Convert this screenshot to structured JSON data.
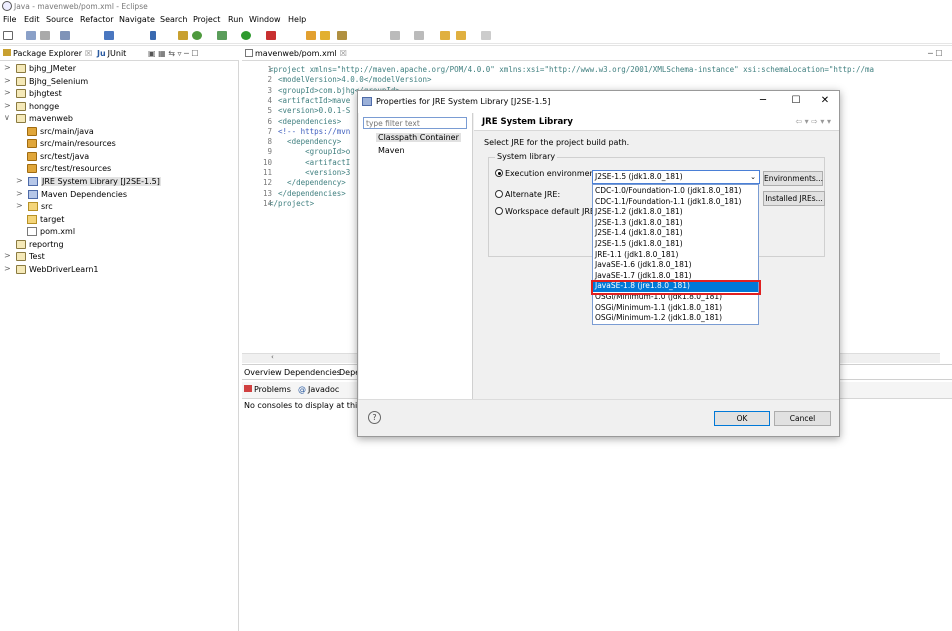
{
  "window": {
    "title": "Java - mavenweb/pom.xml - Eclipse"
  },
  "menu": [
    "File",
    "Edit",
    "Source",
    "Refactor",
    "Navigate",
    "Search",
    "Project",
    "Run",
    "Window",
    "Help"
  ],
  "explorer": {
    "tab_label": "Package Explorer",
    "tab2_label": "JUnit",
    "items": [
      {
        "label": "bjhg_JMeter",
        "expanded": false,
        "icon": "project-icon"
      },
      {
        "label": "Bjhg_Selenium",
        "expanded": false,
        "icon": "project-icon"
      },
      {
        "label": "bjhgtest",
        "expanded": false,
        "icon": "project-icon"
      },
      {
        "label": "hongge",
        "expanded": false,
        "icon": "project-icon"
      },
      {
        "label": "mavenweb",
        "expanded": true,
        "icon": "project-icon"
      },
      {
        "label": "src/main/java",
        "icon": "source-folder-icon"
      },
      {
        "label": "src/main/resources",
        "icon": "source-folder-icon"
      },
      {
        "label": "src/test/java",
        "icon": "source-folder-icon"
      },
      {
        "label": "src/test/resources",
        "icon": "source-folder-icon"
      },
      {
        "label": "JRE System Library [J2SE-1.5]",
        "icon": "library-icon"
      },
      {
        "label": "Maven Dependencies",
        "icon": "library-icon"
      },
      {
        "label": "src",
        "icon": "folder-icon"
      },
      {
        "label": "target",
        "icon": "folder-icon"
      },
      {
        "label": "pom.xml",
        "icon": "xml-file-icon"
      },
      {
        "label": "reportng",
        "icon": "project-icon"
      },
      {
        "label": "Test",
        "icon": "project-icon"
      },
      {
        "label": "WebDriverLearn1",
        "icon": "project-icon"
      }
    ]
  },
  "editor": {
    "tab_label": "mavenweb/pom.xml",
    "lines": [
      {
        "n": "1",
        "text": "<project xmlns=\"http://maven.apache.org/POM/4.0.0\" xmlns:xsi=\"http://www.w3.org/2001/XMLSchema-instance\" xsi:schemaLocation=\"http://ma"
      },
      {
        "n": "2",
        "text": "  <modelVersion>4.0.0</modelVersion>"
      },
      {
        "n": "3",
        "text": "  <groupId>com.bjhg</groupId>"
      },
      {
        "n": "4",
        "text": "  <artifactId>mave"
      },
      {
        "n": "5",
        "text": "  <version>0.0.1-S"
      },
      {
        "n": "6",
        "text": "  <dependencies>"
      },
      {
        "n": "7",
        "text": "  <!-- https://mvn"
      },
      {
        "n": "8",
        "text": "    <dependency>"
      },
      {
        "n": "9",
        "text": "        <groupId>o"
      },
      {
        "n": "10",
        "text": "        <artifactI"
      },
      {
        "n": "11",
        "text": "        <version>3"
      },
      {
        "n": "12",
        "text": "    </dependency>"
      },
      {
        "n": "13",
        "text": "  </dependencies>"
      },
      {
        "n": "14",
        "text": "</project>"
      }
    ],
    "bottom_tabs": [
      "Overview",
      "Dependencies",
      "Depe"
    ]
  },
  "console": {
    "tabs": [
      "Problems",
      "Javadoc"
    ],
    "message": "No consoles to display at this t"
  },
  "dialog": {
    "title": "Properties for JRE System Library [J2SE-1.5]",
    "filter_placeholder": "type filter text",
    "nav": [
      "Classpath Container",
      "Maven"
    ],
    "header": "JRE System Library",
    "description": "Select JRE for the project build path.",
    "group_label": "System library",
    "radio_exec": "Execution environment:",
    "radio_alt": "Alternate JRE:",
    "radio_ws": "Workspace default JRE (j",
    "selected_env": "J2SE-1.5 (jdk1.8.0_181)",
    "btn_environments": "Environments...",
    "btn_installed": "Installed JREs...",
    "options": [
      "CDC-1.0/Foundation-1.0 (jdk1.8.0_181)",
      "CDC-1.1/Foundation-1.1 (jdk1.8.0_181)",
      "J2SE-1.2 (jdk1.8.0_181)",
      "J2SE-1.3 (jdk1.8.0_181)",
      "J2SE-1.4 (jdk1.8.0_181)",
      "J2SE-1.5 (jdk1.8.0_181)",
      "JRE-1.1 (jdk1.8.0_181)",
      "JavaSE-1.6 (jdk1.8.0_181)",
      "JavaSE-1.7 (jdk1.8.0_181)",
      "JavaSE-1.8 (jre1.8.0_181)",
      "OSGi/Minimum-1.0 (jdk1.8.0_181)",
      "OSGi/Minimum-1.1 (jdk1.8.0_181)",
      "OSGi/Minimum-1.2 (jdk1.8.0_181)"
    ],
    "highlighted_option_index": 9,
    "ok_label": "OK",
    "cancel_label": "Cancel",
    "help_label": "?"
  },
  "colors": {
    "highlight_border": "#e02020",
    "selection": "#0078d7"
  }
}
